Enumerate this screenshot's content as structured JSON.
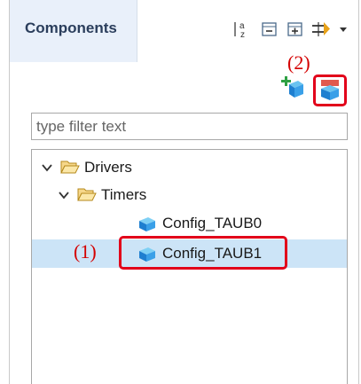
{
  "panel": {
    "title": "Components",
    "toolbar": {
      "sort_icon": "sort-alphabetical-icon",
      "collapse_icon": "collapse-all-icon",
      "expand_icon": "expand-all-icon",
      "filter_icon": "link-filter-icon",
      "menu_icon": "view-menu-icon"
    },
    "actions": {
      "add_icon": "add-component-icon",
      "generate_icon": "generate-code-icon"
    },
    "filter": {
      "placeholder": "type filter text",
      "value": ""
    },
    "tree": {
      "items": [
        {
          "label": "Drivers",
          "level": 0,
          "expanded": true,
          "type": "folder"
        },
        {
          "label": "Timers",
          "level": 1,
          "expanded": true,
          "type": "folder"
        },
        {
          "label": "Config_TAUB0",
          "level": 2,
          "type": "component"
        },
        {
          "label": "Config_TAUB1",
          "level": 2,
          "type": "component",
          "selected": true
        }
      ]
    }
  },
  "annotations": {
    "step1": "(1)",
    "step2": "(2)",
    "color": "#e2001a"
  },
  "colors": {
    "tab_bg": "#e9f0fa",
    "selection": "#cce4f7",
    "title_text": "#2b3e5c"
  }
}
